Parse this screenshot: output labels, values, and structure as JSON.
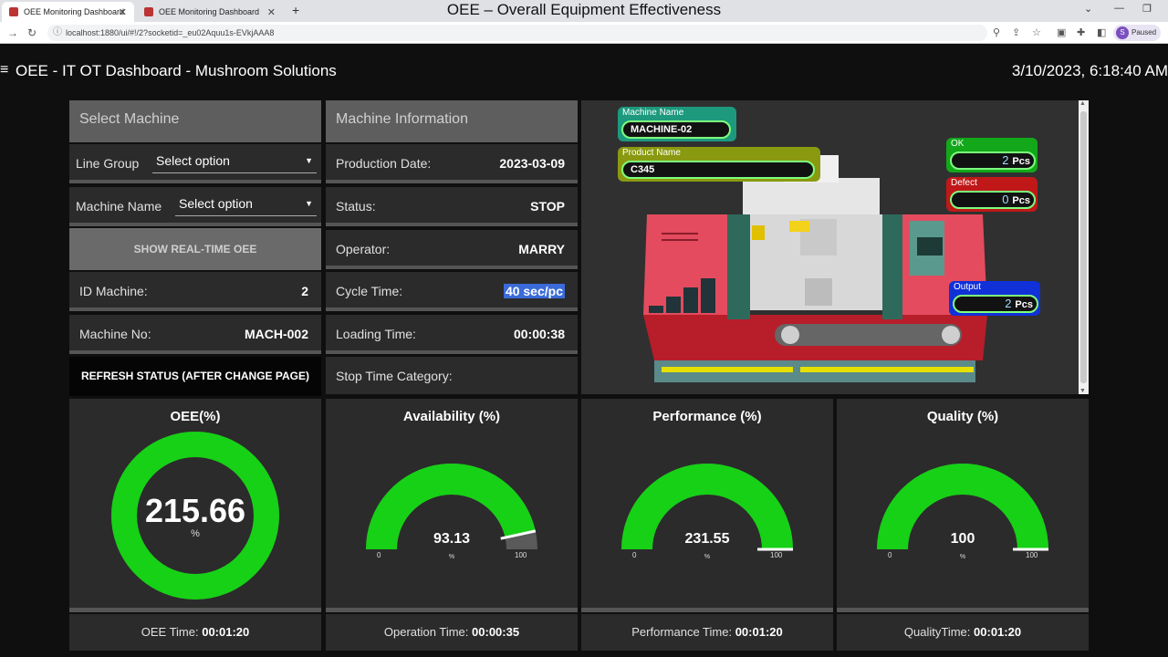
{
  "browser": {
    "tabs": [
      {
        "label": "OEE Monitoring Dashboard",
        "active": true
      },
      {
        "label": "OEE Monitoring Dashboard",
        "active": false
      }
    ],
    "window_title": "OEE – Overall Equipment Effectiveness",
    "url": "localhost:1880/ui/#!/2?socketid=_eu02Aquu1s-EVkjAAA8",
    "profile_status": "Paused",
    "profile_initial": "S"
  },
  "header": {
    "title": "OEE - IT OT Dashboard - Mushroom Solutions",
    "datetime": "3/10/2023, 6:18:40 AM"
  },
  "select_machine": {
    "title": "Select Machine",
    "line_group_label": "Line Group",
    "line_group_value": "Select option",
    "machine_name_label": "Machine Name",
    "machine_name_value": "Select option",
    "show_button": "SHOW REAL-TIME OEE",
    "id_label": "ID Machine:",
    "id_value": "2",
    "no_label": "Machine No:",
    "no_value": "MACH-002",
    "refresh_button": "REFRESH STATUS (AFTER CHANGE PAGE)"
  },
  "machine_info": {
    "title": "Machine Information",
    "rows": [
      {
        "label": "Production Date:",
        "value": "2023-03-09"
      },
      {
        "label": "Status:",
        "value": "STOP"
      },
      {
        "label": "Operator:",
        "value": "MARRY"
      },
      {
        "label": "Cycle Time:",
        "value": "40 sec/pc"
      },
      {
        "label": "Loading Time:",
        "value": "00:00:38"
      },
      {
        "label": "Stop Time Category:",
        "value": ""
      }
    ]
  },
  "machine_view": {
    "machine_name_label": "Machine Name",
    "machine_name_value": "MACHINE-02",
    "product_name_label": "Product Name",
    "product_name_value": "C345",
    "ok_label": "OK",
    "ok_value": "2",
    "defect_label": "Defect",
    "defect_value": "0",
    "output_label": "Output",
    "output_value": "2",
    "unit": "Pcs"
  },
  "gauges": [
    {
      "title": "OEE(%)",
      "value": "215.66",
      "unit": "%",
      "type": "donut",
      "min": "",
      "max": "",
      "fraction": 1.0,
      "footer_label": "OEE Time:",
      "footer_value": "00:01:20"
    },
    {
      "title": "Availability (%)",
      "value": "93.13",
      "unit": "%",
      "type": "arc",
      "min": "0",
      "max": "100",
      "fraction": 0.9313,
      "footer_label": "Operation Time:",
      "footer_value": "00:00:35"
    },
    {
      "title": "Performance (%)",
      "value": "231.55",
      "unit": "%",
      "type": "arc",
      "min": "0",
      "max": "100",
      "fraction": 1.0,
      "footer_label": "Performance Time:",
      "footer_value": "00:01:20"
    },
    {
      "title": "Quality (%)",
      "value": "100",
      "unit": "%",
      "type": "arc",
      "min": "0",
      "max": "100",
      "fraction": 1.0,
      "footer_label": "QualityTime:",
      "footer_value": "00:01:20"
    }
  ],
  "colors": {
    "gauge_fill": "#16d116",
    "gauge_track": "#5a5a5a",
    "panel_bg": "#2b2b2b",
    "header_bg": "#5e5e5e",
    "highlight": "#3a6bd8"
  }
}
